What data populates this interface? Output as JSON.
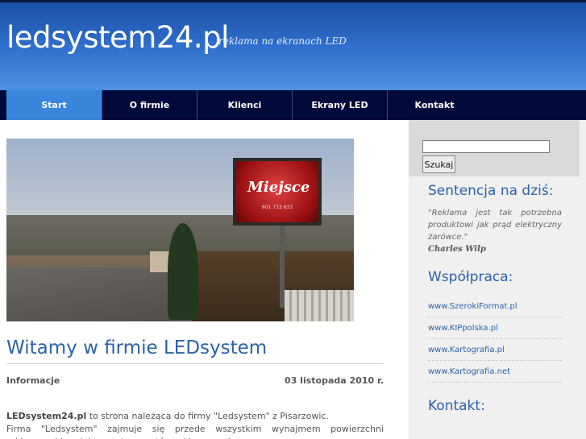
{
  "header": {
    "title": "ledsystem24.pl",
    "tagline": "reklama na ekranach LED"
  },
  "nav": {
    "items": [
      {
        "label": "Start",
        "active": true
      },
      {
        "label": "O firmie",
        "active": false
      },
      {
        "label": "Klienci",
        "active": false
      },
      {
        "label": "Ekrany LED",
        "active": false
      },
      {
        "label": "Kontakt",
        "active": false
      }
    ]
  },
  "hero": {
    "billboard_text": "Miejsce",
    "billboard_phone": "601 733 633"
  },
  "main": {
    "heading": "Witamy w firmie LEDsystem",
    "category": "Informacje",
    "date": "03 listopada 2010 r.",
    "intro_bold": "LEDsystem24.pl",
    "intro_rest": " to strona należąca do firmy \"Ledsystem\" z Pisarzowic.",
    "paragraph2": "Firma \"Ledsystem\" zajmuje się przede wszystkim wynajmem powierzchni reklamowej i projektowaniem spotów reklamowych."
  },
  "sidebar": {
    "search": {
      "value": "",
      "button_label": "Szukaj"
    },
    "sentence_heading": "Sentencja na dziś:",
    "quote_text": "\"Reklama jest tak potrzebna produktowi jak prąd elektryczny żarówce.\"",
    "quote_author": "Charles Wilp",
    "cooperation_heading": "Współpraca:",
    "links": [
      "www.SzerokiFormat.pl",
      "www.KIPpolska.pl",
      "www.Kartografia.pl",
      "www.Kartografia.net"
    ],
    "contact_heading": "Kontakt:"
  },
  "colors": {
    "header_gradient_top": "#1b4fa5",
    "header_gradient_bottom": "#4b91e3",
    "nav_background": "#000a3a",
    "nav_active": "#3a86dc",
    "heading_blue": "#2a62a9"
  }
}
